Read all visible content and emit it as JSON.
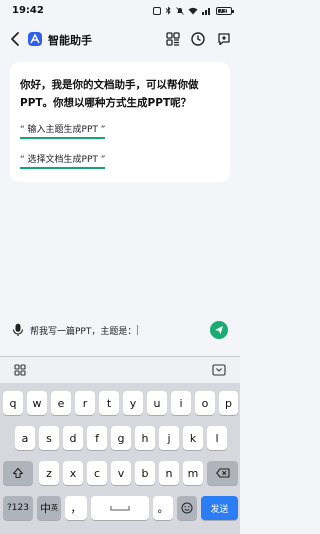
{
  "status": {
    "time": "19:42",
    "battery": "73"
  },
  "nav": {
    "title": "智能助手"
  },
  "message": {
    "text": "你好，我是你的文档助手，可以帮你做PPT。你想以哪种方式生成PPT呢？",
    "option_1": "“ 输入主题生成PPT ”",
    "option_2": "“ 选择文档生成PPT ”"
  },
  "input": {
    "value": "帮我写一篇PPT，主题是："
  },
  "keyboard": {
    "row1": [
      "q",
      "w",
      "e",
      "r",
      "t",
      "y",
      "u",
      "i",
      "o",
      "p"
    ],
    "row2": [
      "a",
      "s",
      "d",
      "f",
      "g",
      "h",
      "j",
      "k",
      "l"
    ],
    "row3": [
      "z",
      "x",
      "c",
      "v",
      "b",
      "n",
      "m"
    ],
    "numbers_key": "?123",
    "lang_key": "中",
    "lang_sub": "英",
    "comma_key": "，",
    "period_key": "。",
    "send_key": "发送"
  },
  "colors": {
    "accent_green": "#1aa37a",
    "send_blue": "#2b7df6",
    "logo_blue": "#2f5ff0"
  }
}
